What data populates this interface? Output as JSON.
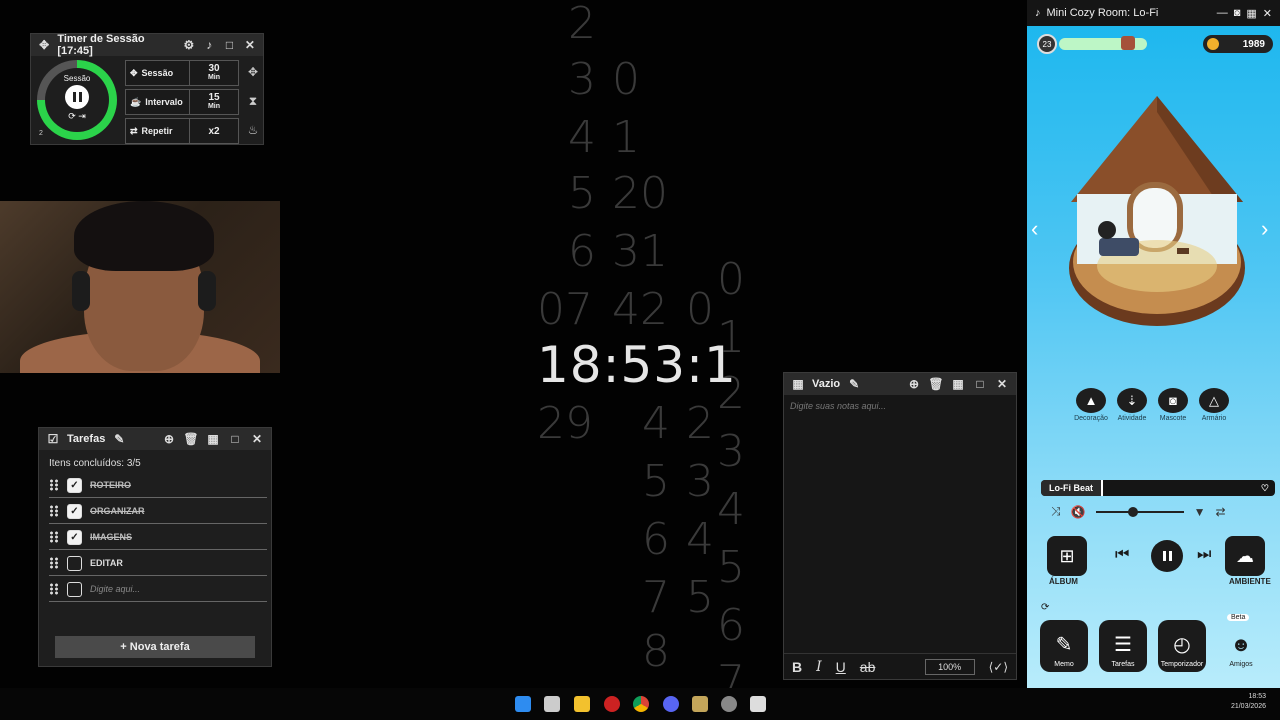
{
  "clock": {
    "time": "18:53:1",
    "column_digits": [
      {
        "text": "2"
      },
      {
        "text": "3"
      },
      {
        "text": "0"
      },
      {
        "text": "4"
      },
      {
        "text": "1"
      },
      {
        "text": "5"
      },
      {
        "text": "20"
      },
      {
        "text": "6"
      },
      {
        "text": "31"
      },
      {
        "text": "07"
      },
      {
        "text": "42"
      },
      {
        "text": "0"
      },
      {
        "text": "0"
      },
      {
        "text": "1"
      },
      {
        "text": "29"
      },
      {
        "text": "4"
      },
      {
        "text": "2"
      },
      {
        "text": "2"
      },
      {
        "text": "5"
      },
      {
        "text": "3"
      },
      {
        "text": "3"
      },
      {
        "text": "6"
      },
      {
        "text": "4"
      },
      {
        "text": "4"
      },
      {
        "text": "7"
      },
      {
        "text": "5"
      },
      {
        "text": "5"
      },
      {
        "text": "8"
      },
      {
        "text": "6"
      },
      {
        "text": "7"
      }
    ]
  },
  "timer": {
    "title": "Timer de Sessão [17:45]",
    "ring_label": "Sessão",
    "ring_progress": 0.75,
    "rows": [
      {
        "name": "Sessão",
        "value": "30",
        "unit": "Min"
      },
      {
        "name": "Intervalo",
        "value": "15",
        "unit": "Min"
      },
      {
        "name": "Repetir",
        "value": "x2",
        "unit": ""
      }
    ],
    "small_label": "2"
  },
  "tasks": {
    "title": "Tarefas",
    "summary": "Itens concluídos: 3/5",
    "items": [
      {
        "label": "ROTEIRO",
        "done": true
      },
      {
        "label": "ORGANIZAR",
        "done": true
      },
      {
        "label": "IMAGENS",
        "done": true
      },
      {
        "label": "EDITAR",
        "done": false
      }
    ],
    "new_placeholder": "Digite aqui...",
    "add_label": "+ Nova tarefa"
  },
  "notes": {
    "title": "Vazio",
    "placeholder": "Digite suas notas aqui...",
    "toolbar": {
      "bold": "B",
      "italic": "I",
      "underline": "U",
      "strike": "ab"
    },
    "zoom": "100%"
  },
  "room": {
    "title": "Mini Cozy Room: Lo-Fi",
    "level": "23",
    "coins": "1989",
    "categories": [
      "Decoração",
      "Atividade",
      "Mascote",
      "Armário"
    ],
    "track": "Lo-Fi Beat",
    "album_label": "ÁLBUM",
    "ambient_label": "AMBIENTE",
    "beta_label": "Beta",
    "dock": [
      "Memo",
      "Tarefas",
      "Temporizador",
      "Amigos"
    ],
    "colors": {
      "sky_top": "#19b6ee",
      "sky_bottom": "#b8ecfb",
      "xp": "#bdf6c6",
      "coin": "#f2b02c"
    }
  },
  "taskbar": {
    "time": "18:53",
    "date": "21/03/2026"
  }
}
